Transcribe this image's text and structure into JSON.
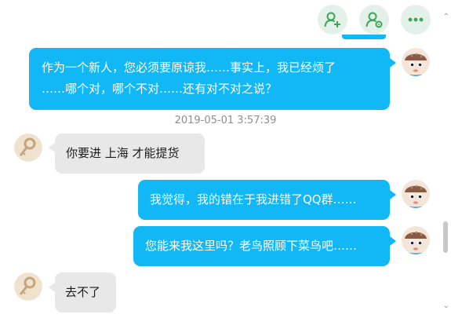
{
  "header": {
    "actions": [
      {
        "icon": "add-contact-icon"
      },
      {
        "icon": "contact-settings-icon"
      },
      {
        "icon": "more-icon"
      }
    ]
  },
  "messages": [
    {
      "side": "out",
      "lines": [
        "作为一个新人，您必须要原谅我……事实上，我已经烦了",
        "……哪个对，哪个不对……还有对不对之说？"
      ]
    },
    {
      "side": "in",
      "text": "你要进 上海 才能提货"
    },
    {
      "side": "out",
      "text": "我觉得，我的错在于我进错了QQ群……"
    },
    {
      "side": "out",
      "text": "您能来我这里吗？老鸟照顾下菜鸟吧……"
    },
    {
      "side": "in",
      "text": "去不了"
    }
  ],
  "timestamp": "2019-05-01 3:57:39",
  "colors": {
    "outgoing_bubble": "#12b7f5",
    "incoming_bubble": "#e8e8e8",
    "header_button_bg": "#e3f1e8",
    "icon_green": "#3fa35e"
  }
}
